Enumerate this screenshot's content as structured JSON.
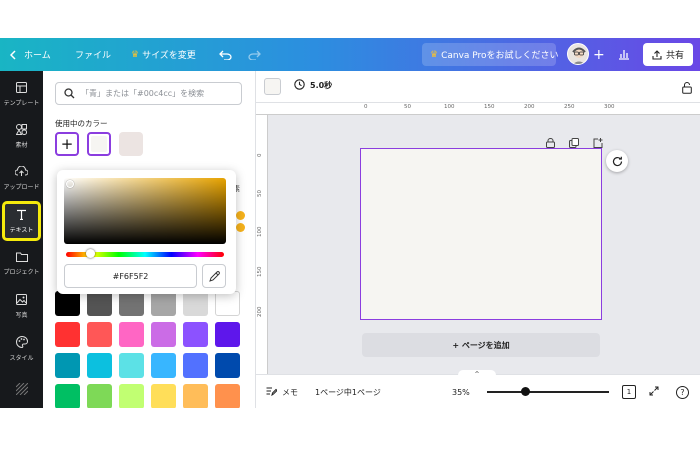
{
  "topbar": {
    "home_label": "ホーム",
    "file_label": "ファイル",
    "resize_label": "サイズを変更",
    "canva_pro_label": "Canva Proをお試しください",
    "share_label": "共有"
  },
  "rail": [
    {
      "label": "テンプレート",
      "icon": "template-icon"
    },
    {
      "label": "素材",
      "icon": "elements-icon"
    },
    {
      "label": "アップロード",
      "icon": "upload-icon"
    },
    {
      "label": "テキスト",
      "icon": "text-icon",
      "active": true
    },
    {
      "label": "プロジェクト",
      "icon": "folder-icon"
    },
    {
      "label": "写真",
      "icon": "photo-icon"
    },
    {
      "label": "スタイル",
      "icon": "palette-icon"
    },
    {
      "label": "",
      "icon": "pattern-icon"
    }
  ],
  "panel": {
    "search_placeholder": "「青」または「#00c4cc」を検索",
    "used_colors_heading": "使用中のカラー",
    "side_text": "素",
    "picker_hex": "#F6F5F2",
    "palette_rows": [
      [
        "#000000",
        "#545454",
        "#737373",
        "#a6a6a6",
        "#d9d9d9",
        "#ffffff"
      ],
      [
        "#ff3131",
        "#ff5757",
        "#ff66c4",
        "#cb6ce6",
        "#8c52ff",
        "#5e17eb"
      ],
      [
        "#0097b2",
        "#0cc0df",
        "#5ce1e6",
        "#38b6ff",
        "#5271ff",
        "#004aad"
      ],
      [
        "#00bf63",
        "#7ed957",
        "#c1ff72",
        "#ffde59",
        "#ffbd59",
        "#ff914d"
      ]
    ],
    "used_colors": [
      "#f6f5f2",
      "#ece4e2"
    ]
  },
  "toolbar": {
    "duration": "5.0秒"
  },
  "ruler": {
    "h_ticks": [
      "0",
      "50",
      "100",
      "150",
      "200",
      "250",
      "300"
    ],
    "v_ticks": [
      "0",
      "50",
      "100",
      "150",
      "200"
    ]
  },
  "canvas": {
    "page_color": "#f6f5f2",
    "add_page_label": "+ ページを追加"
  },
  "bottombar": {
    "notes_label": "メモ",
    "page_indicator": "1ページ中1ページ",
    "zoom": "35%",
    "page_count_badge": "1",
    "help_label": "?"
  },
  "colors": {
    "accent": "#8b3ddf",
    "highlight": "#f5ea0c"
  }
}
